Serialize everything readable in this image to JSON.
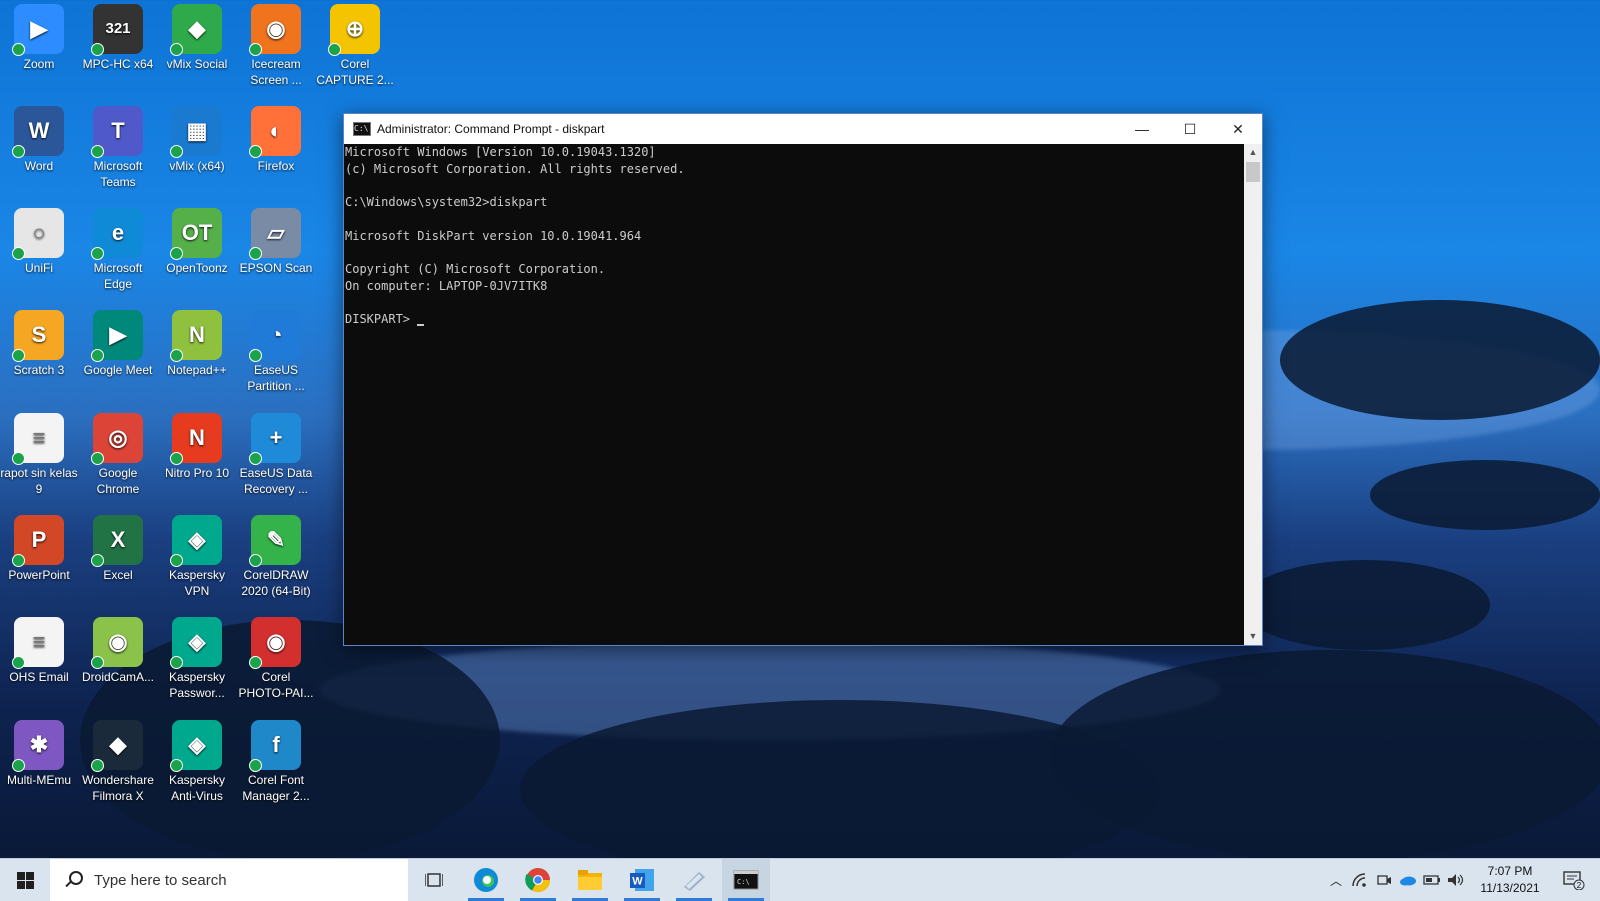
{
  "desktop": {
    "icons": [
      {
        "label": "Zoom",
        "color": "#2d8cff",
        "glyph": "▶"
      },
      {
        "label": "MPC-HC x64",
        "color": "#333333",
        "glyph": "321"
      },
      {
        "label": "vMix Social",
        "color": "#2eaa4a",
        "glyph": "◆"
      },
      {
        "label": "Icecream Screen ...",
        "color": "#f0731e",
        "glyph": "◉"
      },
      {
        "label": "Corel CAPTURE 2...",
        "color": "#f5c400",
        "glyph": "⊕"
      },
      {
        "label": "Word",
        "color": "#2b579a",
        "glyph": "W"
      },
      {
        "label": "Microsoft Teams",
        "color": "#5059c9",
        "glyph": "T"
      },
      {
        "label": "vMix (x64)",
        "color": "#1a7ad0",
        "glyph": "▦"
      },
      {
        "label": "Firefox",
        "color": "#ff7139",
        "glyph": "◐"
      },
      {
        "label": "UniFi",
        "color": "#e6e6e6",
        "glyph": "○"
      },
      {
        "label": "Microsoft Edge",
        "color": "#0f8ad6",
        "glyph": "e"
      },
      {
        "label": "OpenToonz",
        "color": "#56b04a",
        "glyph": "OT"
      },
      {
        "label": "EPSON Scan",
        "color": "#7a8ba6",
        "glyph": "▱"
      },
      {
        "label": "Scratch 3",
        "color": "#f5a623",
        "glyph": "S"
      },
      {
        "label": "Google Meet",
        "color": "#00897b",
        "glyph": "▶"
      },
      {
        "label": "Notepad++",
        "color": "#8fc13e",
        "glyph": "N"
      },
      {
        "label": "EaseUS Partition ...",
        "color": "#1f7ad8",
        "glyph": "◔"
      },
      {
        "label": "rapot sin kelas 9",
        "color": "#f4f4f4",
        "glyph": "≡"
      },
      {
        "label": "Google Chrome",
        "color": "#db4437",
        "glyph": "◎"
      },
      {
        "label": "Nitro Pro 10",
        "color": "#e63b1e",
        "glyph": "N"
      },
      {
        "label": "EaseUS Data Recovery ...",
        "color": "#1f8ad8",
        "glyph": "+"
      },
      {
        "label": "PowerPoint",
        "color": "#d24726",
        "glyph": "P"
      },
      {
        "label": "Excel",
        "color": "#217346",
        "glyph": "X"
      },
      {
        "label": "Kaspersky VPN",
        "color": "#00a88e",
        "glyph": "◈"
      },
      {
        "label": "CorelDRAW 2020 (64-Bit)",
        "color": "#33b34a",
        "glyph": "✎"
      },
      {
        "label": "OHS Email",
        "color": "#f4f4f4",
        "glyph": "≡"
      },
      {
        "label": "DroidCamA...",
        "color": "#8bc34a",
        "glyph": "◉"
      },
      {
        "label": "Kaspersky Passwor...",
        "color": "#00a88e",
        "glyph": "◈"
      },
      {
        "label": "Corel PHOTO-PAI...",
        "color": "#d32f2f",
        "glyph": "◉"
      },
      {
        "label": "Multi-MEmu",
        "color": "#7e57c2",
        "glyph": "✱"
      },
      {
        "label": "Wondershare Filmora X",
        "color": "#1a2a3a",
        "glyph": "◆"
      },
      {
        "label": "Kaspersky Anti-Virus",
        "color": "#00a88e",
        "glyph": "◈"
      },
      {
        "label": "Corel Font Manager 2...",
        "color": "#1e88c8",
        "glyph": "f"
      }
    ]
  },
  "cmd": {
    "title": "Administrator: Command Prompt - diskpart",
    "lines": [
      "Microsoft Windows [Version 10.0.19043.1320]",
      "(c) Microsoft Corporation. All rights reserved.",
      "",
      "C:\\Windows\\system32>diskpart",
      "",
      "Microsoft DiskPart version 10.0.19041.964",
      "",
      "Copyright (C) Microsoft Corporation.",
      "On computer: LAPTOP-0JV7ITK8",
      ""
    ],
    "prompt": "DISKPART> ",
    "controls": {
      "minimize": "—",
      "maximize": "☐",
      "close": "✕"
    }
  },
  "taskbar": {
    "search_placeholder": "Type here to search",
    "apps": [
      "task-view",
      "edge",
      "chrome",
      "file-explorer",
      "word",
      "epson-scan",
      "command-prompt"
    ],
    "time": "7:07 PM",
    "date": "11/13/2021",
    "notification_count": "2"
  }
}
